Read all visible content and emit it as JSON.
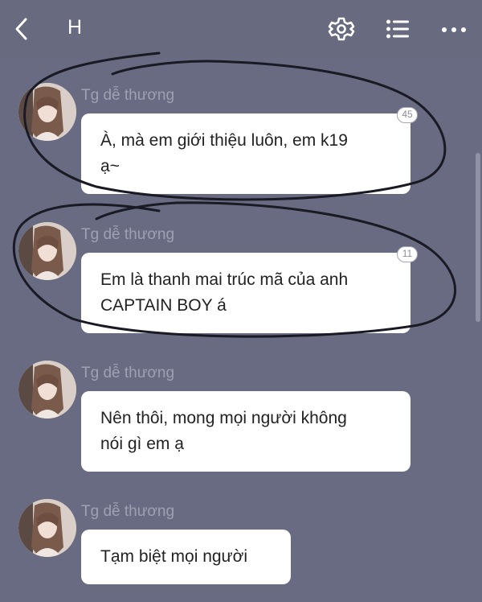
{
  "header": {
    "title": "H",
    "icons": [
      "chevron-left-icon",
      "gear-icon",
      "list-icon",
      "more-icon"
    ]
  },
  "messages": [
    {
      "sender": "Tg dễ thương",
      "lines": [
        "À, mà em giới thiệu luôn, em k19",
        "ạ~"
      ],
      "badge": "45"
    },
    {
      "sender": "Tg dễ thương",
      "lines": [
        "Em là thanh mai trúc mã của anh",
        "CAPTAIN BOY á"
      ],
      "badge": "11"
    },
    {
      "sender": "Tg dễ thương",
      "lines": [
        "Nên thôi, mong mọi người không",
        "nói gì em ạ"
      ]
    },
    {
      "sender": "Tg dễ thương",
      "lines": [
        "Tạm biệt mọi người"
      ]
    }
  ],
  "colors": {
    "background": "#696b82",
    "bubble": "#ffffff",
    "sender_text": "#9ea0b3",
    "annotation_stroke": "#1a1a24"
  }
}
